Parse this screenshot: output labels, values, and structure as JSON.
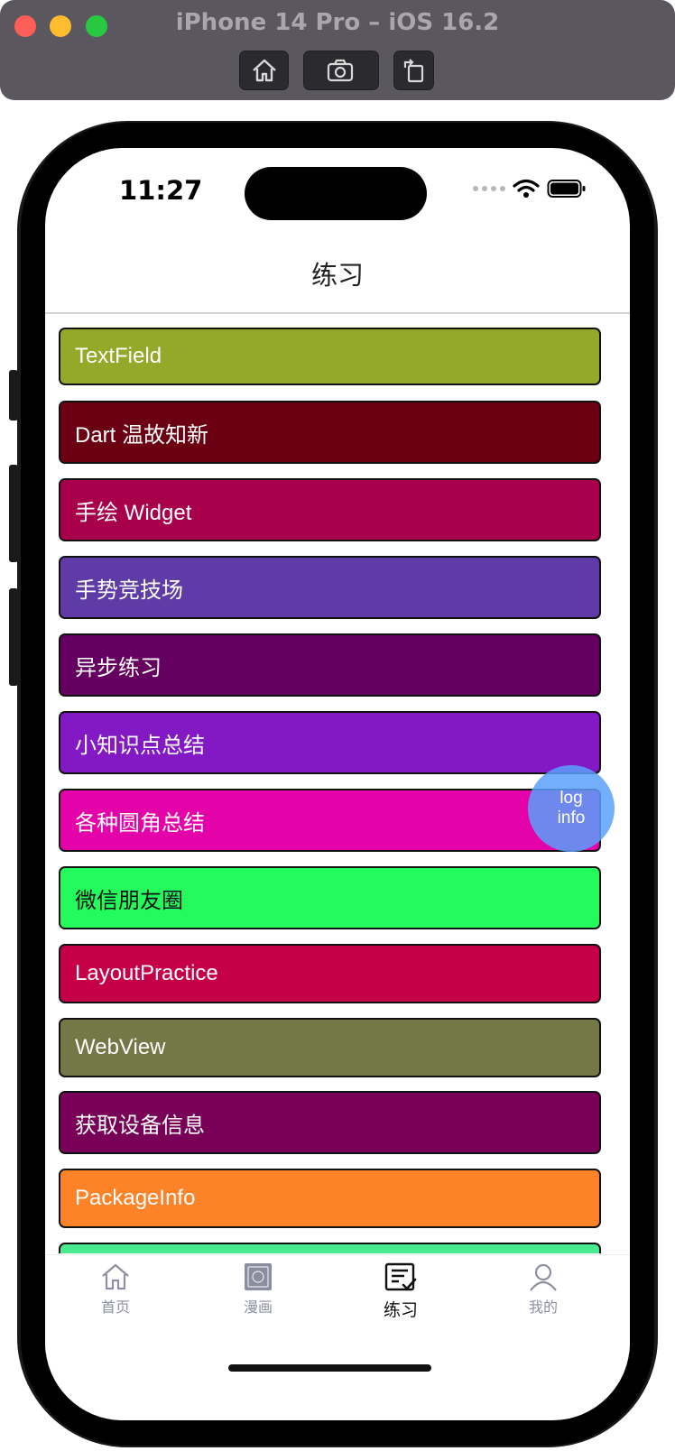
{
  "window": {
    "title": "iPhone 14 Pro – iOS 16.2",
    "toolbar": [
      "home-button",
      "screenshot-button",
      "rotate-button"
    ]
  },
  "status_bar": {
    "time": "11:27"
  },
  "nav": {
    "title": "练习"
  },
  "list": [
    {
      "label": "TextField",
      "color": "#94a829"
    },
    {
      "label": "Dart 温故知新",
      "color": "#6b0012"
    },
    {
      "label": "手绘 Widget",
      "color": "#a8004a"
    },
    {
      "label": "手势竞技场",
      "color": "#5e3ba6"
    },
    {
      "label": "异步练习",
      "color": "#650060"
    },
    {
      "label": "小知识点总结",
      "color": "#8219c4"
    },
    {
      "label": "各种圆角总结",
      "color": "#e303a9"
    },
    {
      "label": "微信朋友圈",
      "color": "#23fa5c",
      "text_color": "#111111"
    },
    {
      "label": "LayoutPractice",
      "color": "#c60047"
    },
    {
      "label": "WebView",
      "color": "#737846"
    },
    {
      "label": "获取设备信息",
      "color": "#780057"
    },
    {
      "label": "PackageInfo",
      "color": "#fe8228"
    },
    {
      "label": "",
      "color": "#4cea90"
    }
  ],
  "log_button": {
    "line1": "log",
    "line2": "info"
  },
  "tabs": [
    {
      "label": "首页",
      "icon": "home-icon",
      "active": false
    },
    {
      "label": "漫画",
      "icon": "comic-icon",
      "active": false
    },
    {
      "label": "练习",
      "icon": "practice-list-icon",
      "active": true
    },
    {
      "label": "我的",
      "icon": "profile-icon",
      "active": false
    }
  ]
}
